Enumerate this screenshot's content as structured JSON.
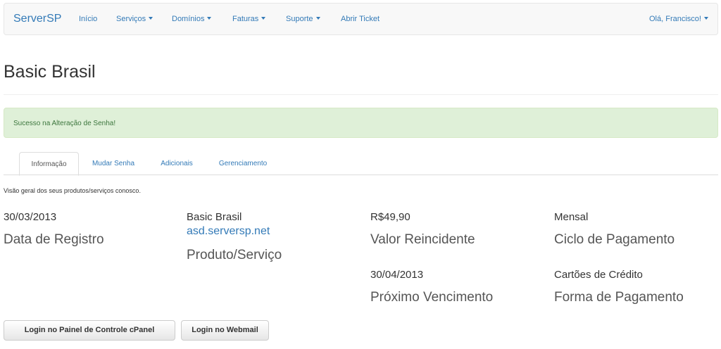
{
  "navbar": {
    "brand": "ServerSP",
    "items": [
      {
        "label": "Início",
        "dropdown": false
      },
      {
        "label": "Serviços",
        "dropdown": true
      },
      {
        "label": "Domínios",
        "dropdown": true
      },
      {
        "label": "Faturas",
        "dropdown": true
      },
      {
        "label": "Suporte",
        "dropdown": true
      },
      {
        "label": "Abrir Ticket",
        "dropdown": false
      }
    ],
    "user_menu": "Olá, Francisco!"
  },
  "page": {
    "title": "Basic Brasil"
  },
  "alert": {
    "text": "Sucesso na Alteração de Senha!"
  },
  "tabs": [
    {
      "label": "Informação",
      "active": true
    },
    {
      "label": "Mudar Senha",
      "active": false
    },
    {
      "label": "Adicionais",
      "active": false
    },
    {
      "label": "Gerenciamento",
      "active": false
    }
  ],
  "overview_text": "Visão geral dos seus produtos/serviços conosco.",
  "details": {
    "registration": {
      "value": "30/03/2013",
      "label": "Data de Registro"
    },
    "product": {
      "value": "Basic Brasil",
      "domain": "asd.serversp.net",
      "label": "Produto/Serviço"
    },
    "recurring": {
      "value": "R$49,90",
      "label": "Valor Reincidente"
    },
    "cycle": {
      "value": "Mensal",
      "label": "Ciclo de Pagamento"
    },
    "next_due": {
      "value": "30/04/2013",
      "label": "Próximo Vencimento"
    },
    "payment_method": {
      "value": "Cartões de Crédito",
      "label": "Forma de Pagamento"
    }
  },
  "buttons": {
    "cpanel": "Login no Painel de Controle cPanel",
    "webmail": "Login no Webmail"
  },
  "colors": {
    "link": "#337ab7",
    "alert_bg": "#dff0d8",
    "alert_text": "#3c763d",
    "navbar_bg": "#f8f8f8"
  }
}
